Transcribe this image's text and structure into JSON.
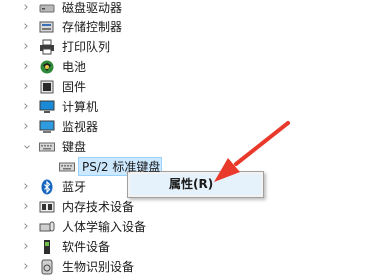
{
  "tree": {
    "items": [
      {
        "label": "磁盘驱动器",
        "icon": "disk-drive-icon",
        "expanded": false
      },
      {
        "label": "存储控制器",
        "icon": "storage-controller-icon",
        "expanded": false
      },
      {
        "label": "打印队列",
        "icon": "printer-icon",
        "expanded": false
      },
      {
        "label": "电池",
        "icon": "battery-icon",
        "expanded": false
      },
      {
        "label": "固件",
        "icon": "firmware-icon",
        "expanded": false
      },
      {
        "label": "计算机",
        "icon": "computer-icon",
        "expanded": false
      },
      {
        "label": "监视器",
        "icon": "monitor-icon",
        "expanded": false
      },
      {
        "label": "键盘",
        "icon": "keyboard-icon",
        "expanded": true
      },
      {
        "label": "PS/2 标准键盘",
        "icon": "keyboard-icon",
        "child": true,
        "selected": true
      },
      {
        "label": "蓝牙",
        "icon": "bluetooth-icon",
        "expanded": false
      },
      {
        "label": "内存技术设备",
        "icon": "memory-device-icon",
        "expanded": false
      },
      {
        "label": "人体学输入设备",
        "icon": "hid-icon",
        "expanded": false
      },
      {
        "label": "软件设备",
        "icon": "software-device-icon",
        "expanded": false
      },
      {
        "label": "生物识别设备",
        "icon": "biometric-icon",
        "expanded": false
      }
    ]
  },
  "context_menu": {
    "properties_label": "属性(R)"
  },
  "colors": {
    "selection": "#cce8ff",
    "arrow": "#e8392b"
  }
}
